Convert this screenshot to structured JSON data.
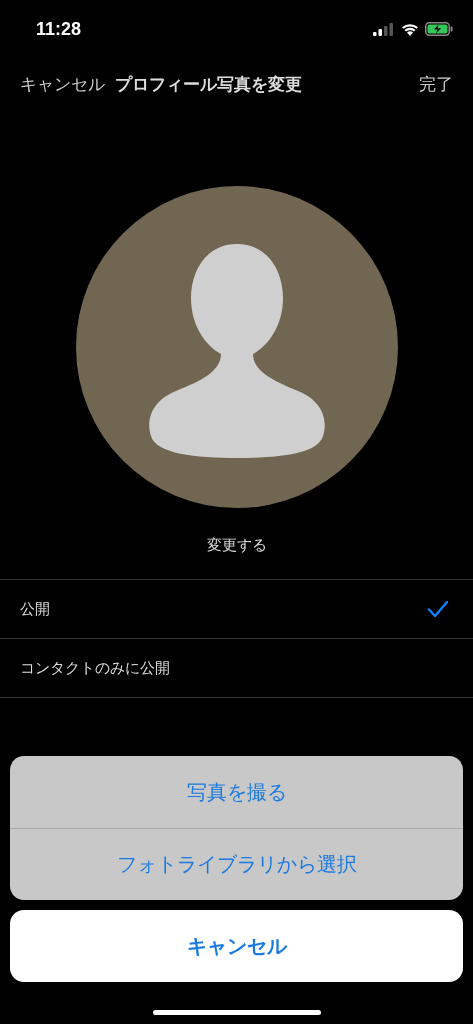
{
  "status_bar": {
    "time": "11:28",
    "charging": true
  },
  "nav": {
    "cancel": "キャンセル",
    "title": "プロフィール写真を変更",
    "done": "完了"
  },
  "change_link": "変更する",
  "visibility_options": [
    {
      "label": "公開",
      "selected": true
    },
    {
      "label": "コンタクトのみに公開",
      "selected": false
    }
  ],
  "action_sheet": {
    "actions": [
      "写真を撮る",
      "フォトライブラリから選択"
    ],
    "cancel": "キャンセル"
  }
}
